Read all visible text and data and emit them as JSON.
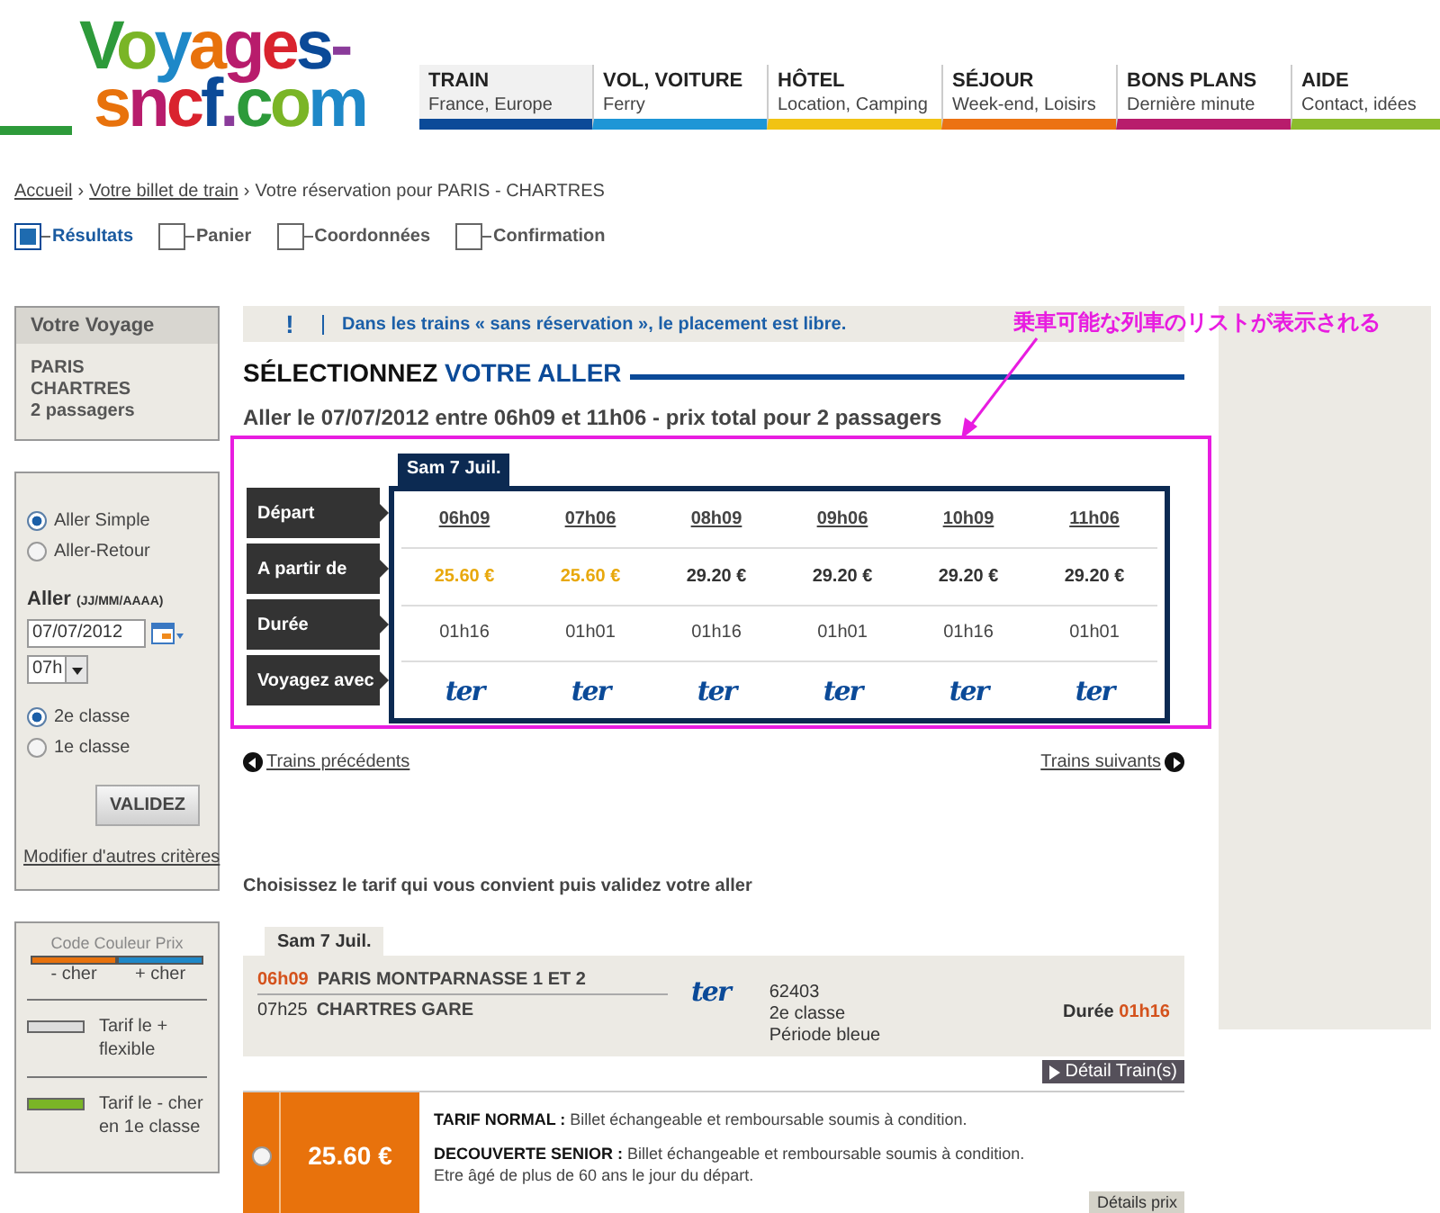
{
  "logo": {
    "line_1": "Voyages-",
    "line_2": "sncf.com"
  },
  "nav": [
    {
      "title": "TRAIN",
      "subtitle": "France, Europe",
      "selected": true,
      "color": "#0b4a98"
    },
    {
      "title": "VOL, VOITURE",
      "subtitle": "Ferry",
      "selected": false,
      "color": "#1e96d6"
    },
    {
      "title": "HÔTEL",
      "subtitle": "Location, Camping",
      "selected": false,
      "color": "#f1c313"
    },
    {
      "title": "SÉJOUR",
      "subtitle": "Week-end, Loisirs",
      "selected": false,
      "color": "#ec7212"
    },
    {
      "title": "BONS PLANS",
      "subtitle": "Dernière minute",
      "selected": false,
      "color": "#b81c6c"
    },
    {
      "title": "AIDE",
      "subtitle": "Contact, idées",
      "selected": false,
      "color": "#8cbc2c"
    }
  ],
  "breadcrumb": {
    "separator": "›",
    "items": [
      {
        "label": "Accueil",
        "link": true
      },
      {
        "label": "Votre billet de train",
        "link": true
      },
      {
        "label": "Votre réservation pour PARIS - CHARTRES",
        "link": false
      }
    ]
  },
  "steps": [
    {
      "label": "Résultats",
      "selected": true
    },
    {
      "label": "Panier",
      "selected": false
    },
    {
      "label": "Coordonnées",
      "selected": false
    },
    {
      "label": "Confirmation",
      "selected": false
    }
  ],
  "trip_summary": {
    "title": "Votre Voyage",
    "lines": [
      "PARIS",
      "CHARTRES",
      "2 passagers"
    ]
  },
  "search_form": {
    "trip_types": [
      {
        "label": "Aller Simple",
        "selected": true
      },
      {
        "label": "Aller-Retour",
        "selected": false
      }
    ],
    "date_label": "Aller",
    "date_format": "(JJ/MM/AAAA)",
    "date": "07/07/2012",
    "hour": "07h",
    "classes": [
      {
        "label": "2e classe",
        "selected": true
      },
      {
        "label": "1e classe",
        "selected": false
      }
    ],
    "submit": "VALIDEZ",
    "more_link": "Modifier d'autres critères"
  },
  "legend": {
    "title": "Code Couleur Prix",
    "scale": [
      {
        "label": "- cher",
        "color": "#e8720c"
      },
      {
        "label": "+ cher",
        "color": "#1e88c8"
      }
    ],
    "items": [
      {
        "label": "Tarif le + flexible",
        "color": "#dddddd"
      },
      {
        "label": "Tarif le - cher en 1e classe",
        "color": "#7ab526"
      }
    ]
  },
  "notice": {
    "icon": "!",
    "text": "Dans les trains « sans réservation », le placement est libre."
  },
  "heading": {
    "part_1": "SÉLECTIONNEZ",
    "part_2": "VOTRE ALLER"
  },
  "subheading": "Aller le 07/07/2012 entre 06h09 et 11h06 - prix total pour 2 passagers",
  "timetable": {
    "date_tab": "Sam 7 Juil.",
    "row_labels": [
      "Départ",
      "A partir de",
      "Durée",
      "Voyagez avec"
    ],
    "trains": [
      {
        "departure": "06h09",
        "price": "25.60 €",
        "cheapest": true,
        "duration": "01h16",
        "operator": "ter"
      },
      {
        "departure": "07h06",
        "price": "25.60 €",
        "cheapest": true,
        "duration": "01h01",
        "operator": "ter"
      },
      {
        "departure": "08h09",
        "price": "29.20 €",
        "cheapest": false,
        "duration": "01h16",
        "operator": "ter"
      },
      {
        "departure": "09h06",
        "price": "29.20 €",
        "cheapest": false,
        "duration": "01h01",
        "operator": "ter"
      },
      {
        "departure": "10h09",
        "price": "29.20 €",
        "cheapest": false,
        "duration": "01h16",
        "operator": "ter"
      },
      {
        "departure": "11h06",
        "price": "29.20 €",
        "cheapest": false,
        "duration": "01h01",
        "operator": "ter"
      }
    ]
  },
  "annotation": {
    "text": "乗車可能な列車のリストが表示される"
  },
  "pager": {
    "previous": "Trains précédents",
    "next": "Trains suivants"
  },
  "fare_prompt": "Choisissez le tarif qui vous convient puis validez votre aller",
  "selected_train": {
    "date_tab": "Sam 7 Juil.",
    "departure_time": "06h09",
    "departure_station": "PARIS MONTPARNASSE 1 ET 2",
    "arrival_time": "07h25",
    "arrival_station": "CHARTRES GARE",
    "operator": "ter",
    "train_number": "62403",
    "class": "2e classe",
    "period": "Période bleue",
    "duration_label": "Durée",
    "duration": "01h16",
    "detail_button": "Détail Train(s)"
  },
  "fares": [
    {
      "price": "25.60 €",
      "selected": false,
      "color": "#e8720c",
      "descriptions": [
        {
          "name": "TARIF NORMAL :",
          "text": "Billet échangeable et remboursable soumis à condition."
        },
        {
          "name": "DECOUVERTE SENIOR :",
          "text": "Billet échangeable et remboursable soumis à condition.",
          "note": "Etre âgé de plus de 60 ans le jour du départ."
        }
      ],
      "detail_button": "Détails prix"
    }
  ]
}
